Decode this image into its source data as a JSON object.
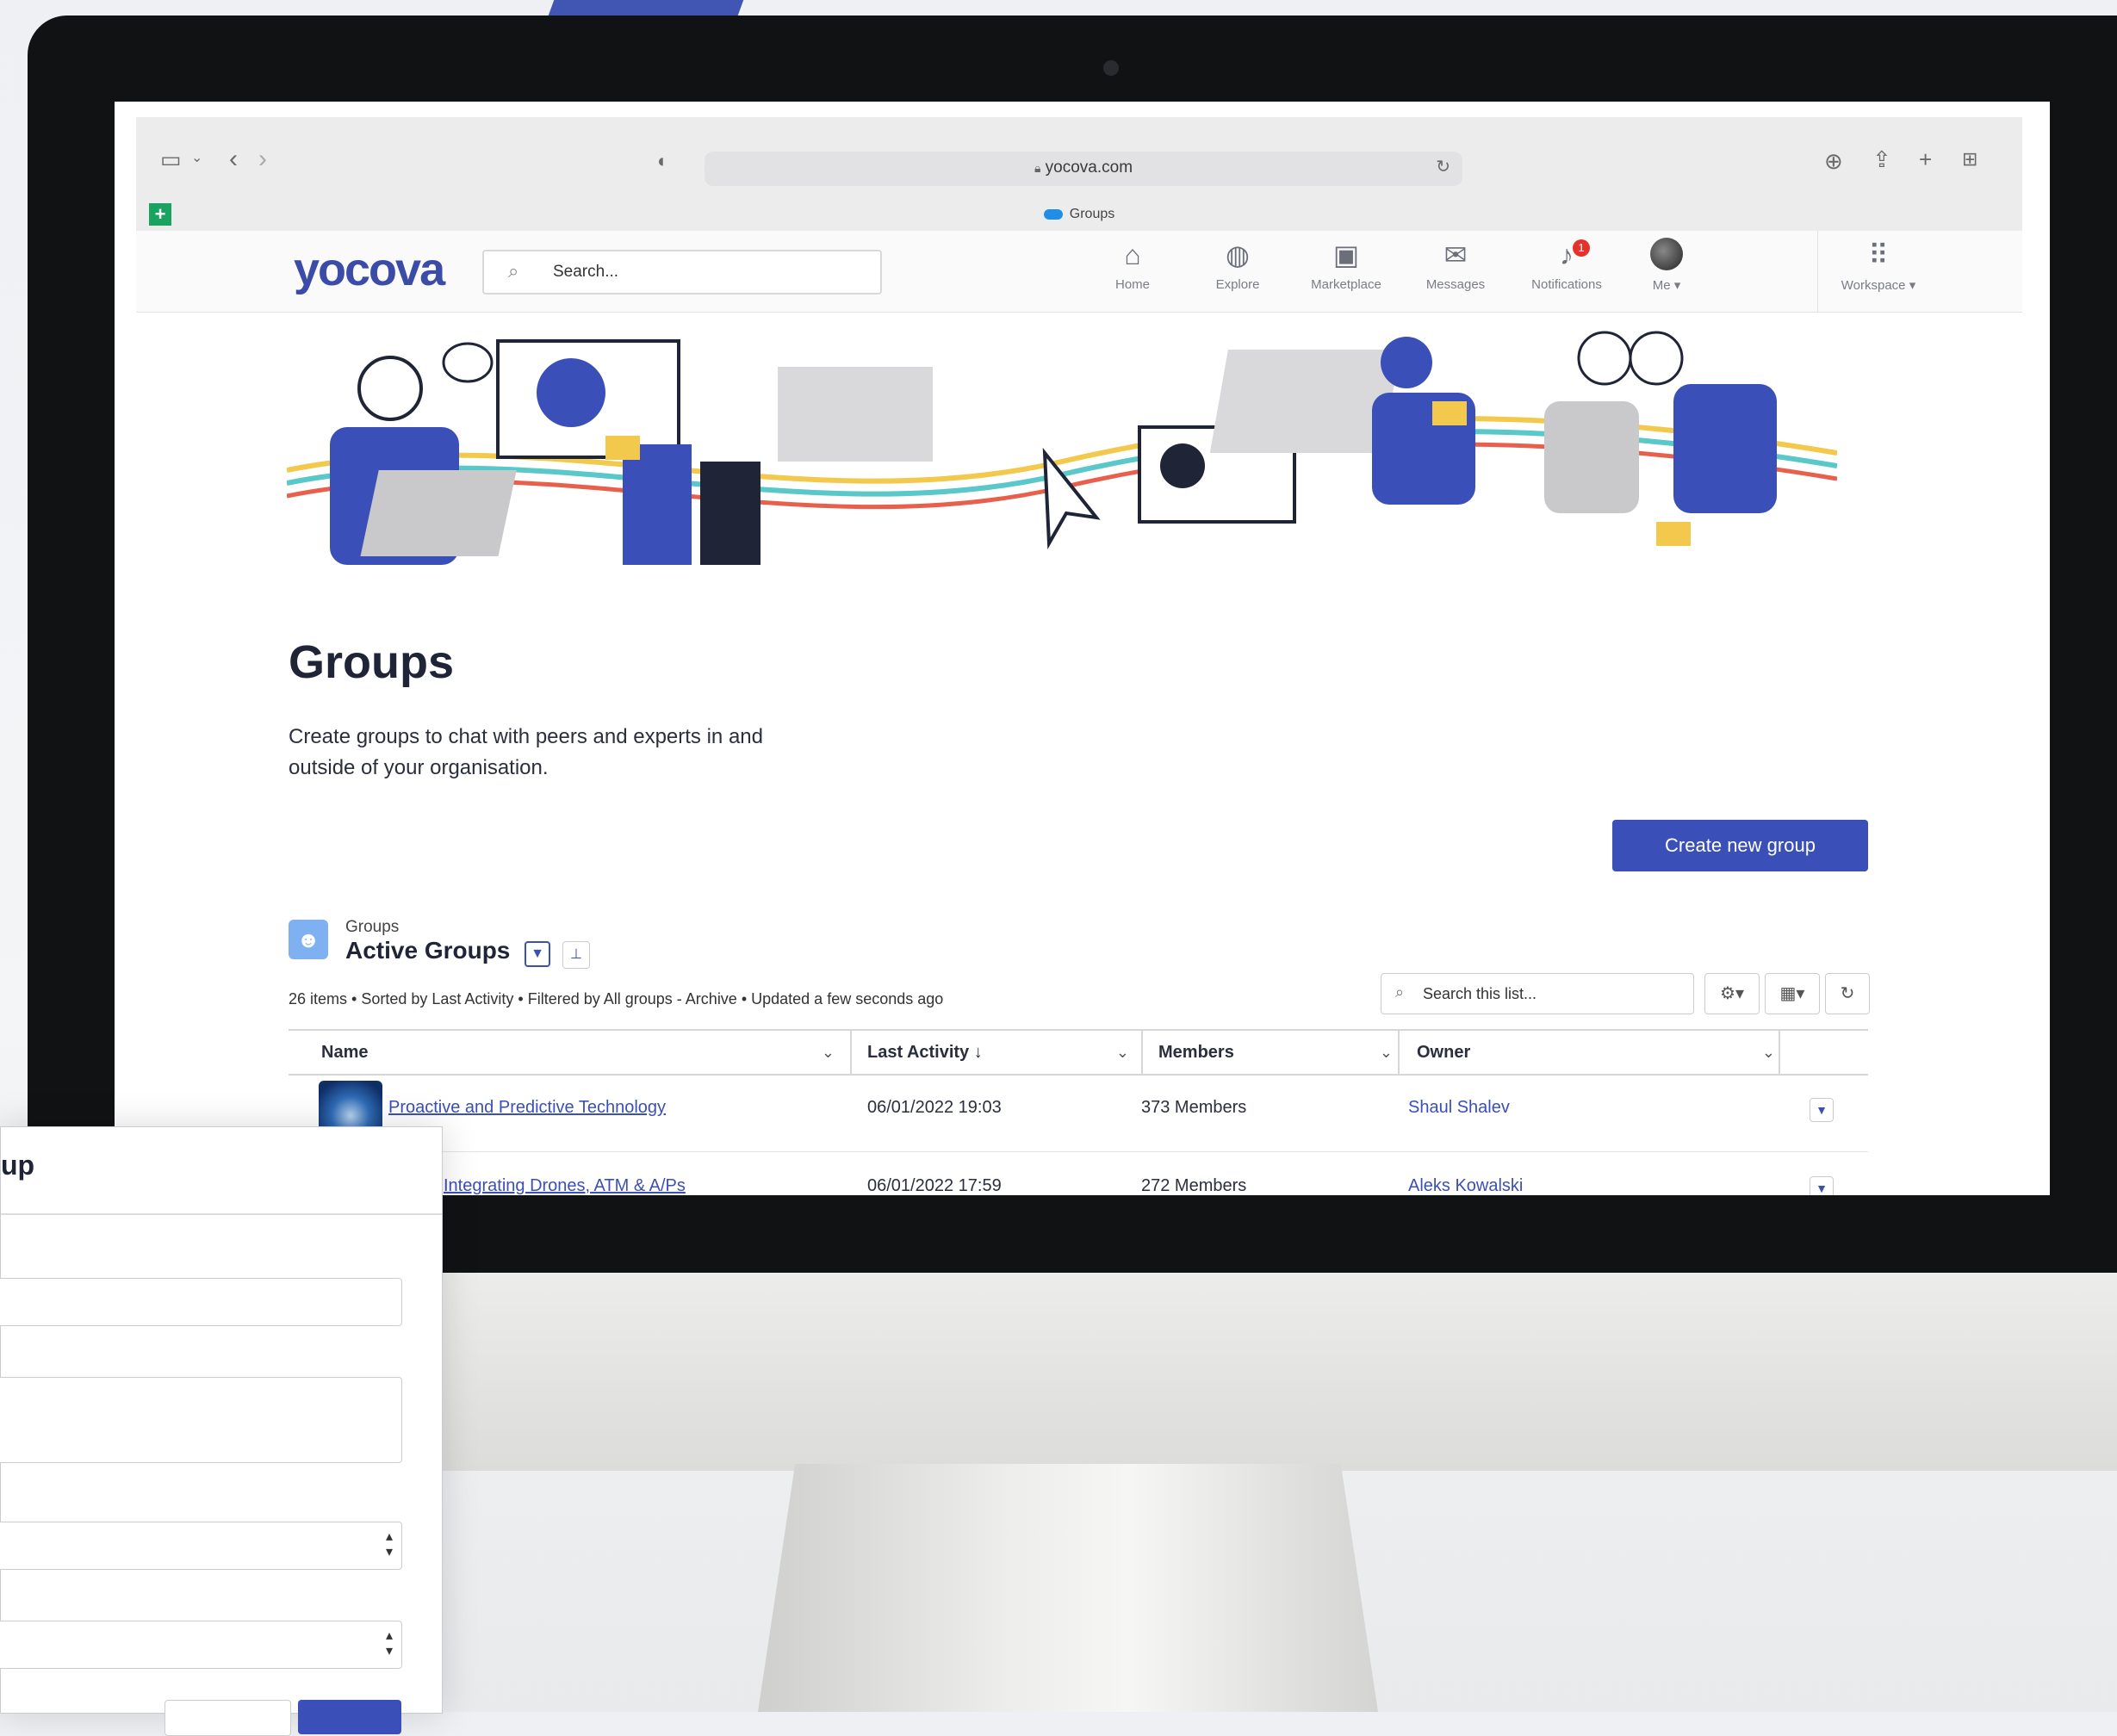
{
  "browser": {
    "url": "yocova.com",
    "tab_title": "Groups"
  },
  "app": {
    "logo": "yocova",
    "search_placeholder": "Search...",
    "nav": [
      {
        "label": "Home",
        "icon": "home-icon"
      },
      {
        "label": "Explore",
        "icon": "globe-icon"
      },
      {
        "label": "Marketplace",
        "icon": "monitor-icon"
      },
      {
        "label": "Messages",
        "icon": "envelope-icon"
      },
      {
        "label": "Notifications",
        "icon": "bell-icon",
        "badge": "1"
      },
      {
        "label": "Me",
        "icon": "avatar"
      },
      {
        "label": "Workspace",
        "icon": "grid-icon"
      }
    ]
  },
  "page": {
    "title": "Groups",
    "description": "Create groups to chat with peers and experts in and outside of your organisation.",
    "create_button": "Create new group"
  },
  "list_view": {
    "object_label": "Groups",
    "name": "Active Groups",
    "meta": "26 items • Sorted by Last Activity • Filtered by All groups - Archive • Updated a few seconds ago",
    "search_placeholder": "Search this list...",
    "columns": [
      "Name",
      "Last Activity ↓",
      "Members",
      "Owner"
    ],
    "rows": [
      {
        "name": "Proactive and Predictive Technology",
        "last_activity": "06/01/2022 19:03",
        "members": "373 Members",
        "owner": "Shaul Shalev"
      },
      {
        "name": "Integrating Drones, ATM & A/Ps",
        "last_activity": "06/01/2022 17:59",
        "members": "272 Members",
        "owner": "Aleks Kowalski"
      }
    ]
  },
  "modal": {
    "title_fragment": "up"
  },
  "colors": {
    "brand": "#3b4ca8",
    "primary_button": "#3b4fb8",
    "notification_badge": "#e5322c"
  }
}
